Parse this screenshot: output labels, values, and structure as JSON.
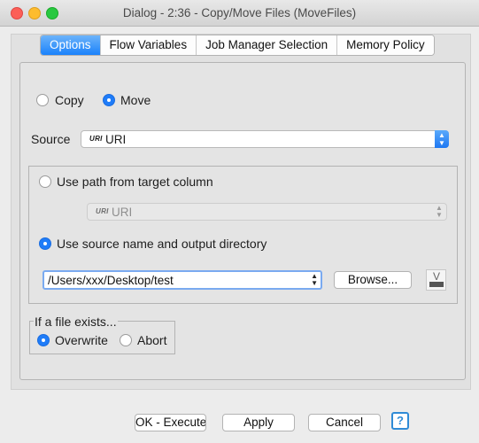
{
  "window": {
    "title": "Dialog - 2:36 - Copy/Move Files (MoveFiles)"
  },
  "tabs": [
    {
      "label": "Options",
      "active": true
    },
    {
      "label": "Flow Variables",
      "active": false
    },
    {
      "label": "Job Manager Selection",
      "active": false
    },
    {
      "label": "Memory Policy",
      "active": false
    }
  ],
  "operation": {
    "copy_label": "Copy",
    "move_label": "Move",
    "selected": "Move"
  },
  "source": {
    "label": "Source",
    "type_badge": "URI",
    "value": "URI"
  },
  "target": {
    "use_path_label": "Use path from target column",
    "column_badge": "URI",
    "column_value": "URI",
    "use_source_name_label": "Use source name and output directory",
    "selected": "Use source name and output directory",
    "output_directory": "/Users/xxx/Desktop/test",
    "browse_label": "Browse...",
    "variable_icon_label": "V"
  },
  "if_exists": {
    "legend": "If a file exists...",
    "overwrite_label": "Overwrite",
    "abort_label": "Abort",
    "selected": "Overwrite"
  },
  "footer": {
    "ok_label": "OK - Execute",
    "apply_label": "Apply",
    "cancel_label": "Cancel",
    "help_label": "?"
  },
  "colors": {
    "accent": "#1f7cf8",
    "window_bg": "#ececec"
  }
}
